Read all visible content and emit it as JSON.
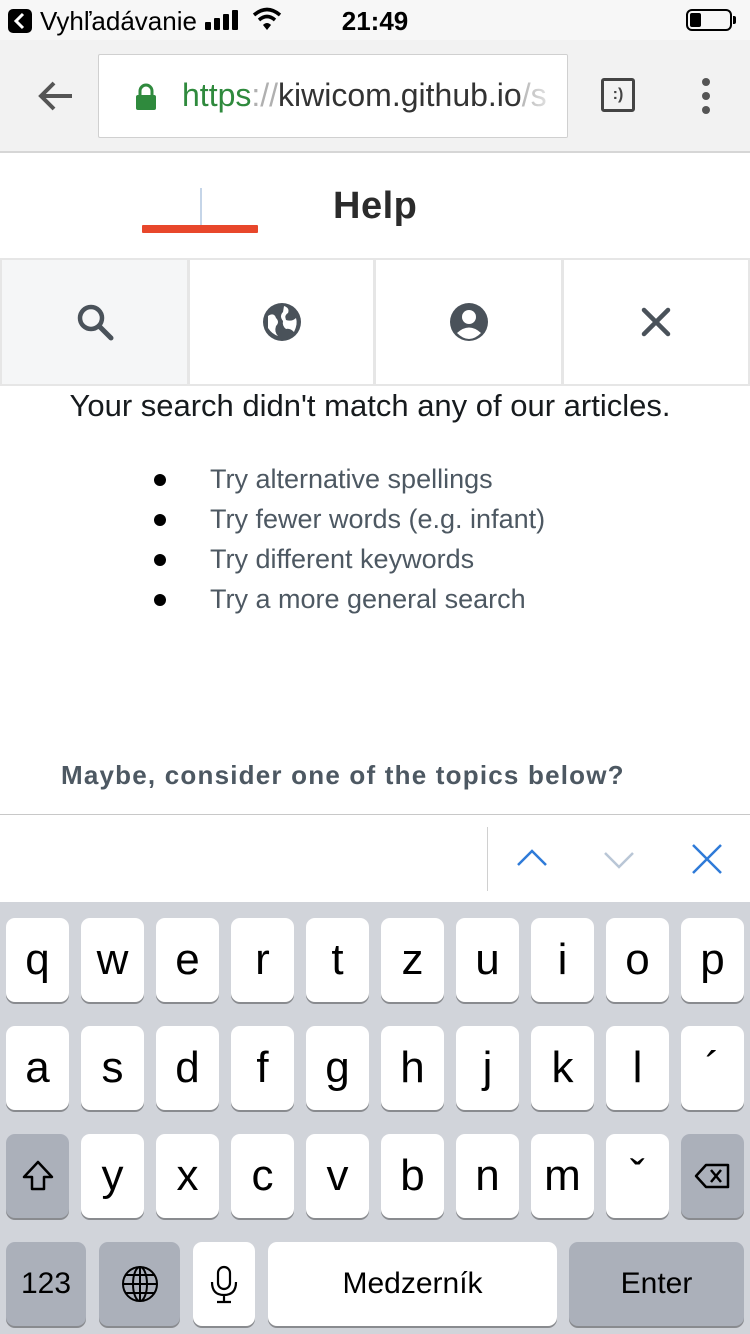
{
  "status_bar": {
    "back_to_app": "Vyhľadávanie",
    "time": "21:49",
    "battery_level": 0.3
  },
  "browser": {
    "url_scheme": "https",
    "url_separator": "://",
    "url_host": "kiwicom.github.io",
    "url_tail": "/s",
    "tab_switcher_label": ":)"
  },
  "header": {
    "title": "Help"
  },
  "tabs": [
    {
      "icon": "search-icon",
      "active": true
    },
    {
      "icon": "globe-icon",
      "active": false
    },
    {
      "icon": "account-icon",
      "active": false
    },
    {
      "icon": "close-icon",
      "active": false
    }
  ],
  "search_results": {
    "no_match_message": "Your search didn't match any of our articles.",
    "tips": [
      "Try alternative spellings",
      "Try fewer words (e.g. infant)",
      "Try different keywords",
      "Try a more general search"
    ],
    "topics_hint": "Maybe, consider one of the topics below?"
  },
  "find_bar": {
    "previous": "chevron-up-icon",
    "next": "chevron-down-icon",
    "close": "close-icon"
  },
  "keyboard": {
    "row1": [
      "q",
      "w",
      "e",
      "r",
      "t",
      "z",
      "u",
      "i",
      "o",
      "p"
    ],
    "row2": [
      "a",
      "s",
      "d",
      "f",
      "g",
      "h",
      "j",
      "k",
      "l",
      "´"
    ],
    "row3": [
      "y",
      "x",
      "c",
      "v",
      "b",
      "n",
      "m",
      "ˇ"
    ],
    "numbers_key": "123",
    "space_key": "Medzerník",
    "enter_key": "Enter"
  },
  "colors": {
    "accent_green": "#2f8a3d",
    "logo_red": "#e8472b",
    "find_bar_blue": "#2f7bd8",
    "keyboard_bg": "#d1d4da"
  }
}
